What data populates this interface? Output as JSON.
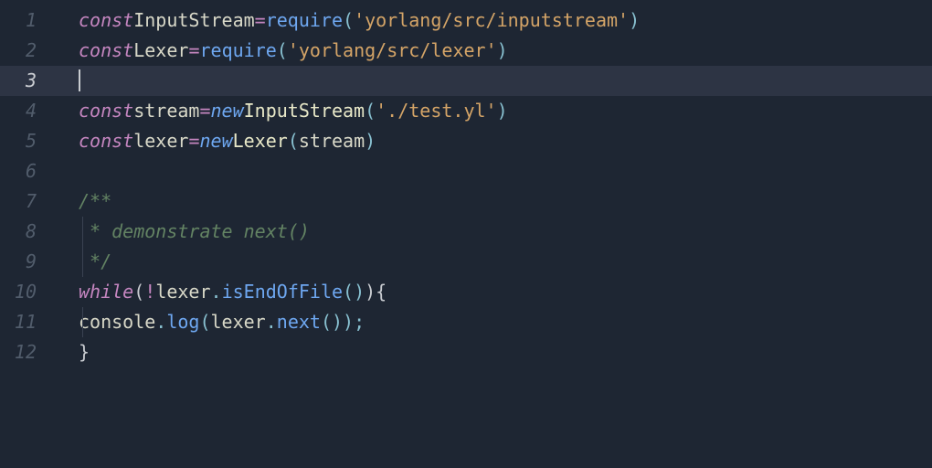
{
  "gutter": {
    "lines": [
      "1",
      "2",
      "3",
      "4",
      "5",
      "6",
      "7",
      "8",
      "9",
      "10",
      "11",
      "12"
    ],
    "active_line": 3
  },
  "code": {
    "l1": {
      "kw_const": "const",
      "var": "InputStream",
      "op_eq": "=",
      "fn": "require",
      "paren_o": "(",
      "str": "'yorlang/src/inputstream'",
      "paren_c": ")"
    },
    "l2": {
      "kw_const": "const",
      "var": "Lexer",
      "op_eq": "=",
      "fn": "require",
      "paren_o": "(",
      "str": "'yorlang/src/lexer'",
      "paren_c": ")"
    },
    "l4": {
      "kw_const": "const",
      "var": "stream",
      "op_eq": "=",
      "kw_new": "new",
      "class": "InputStream",
      "paren_o": "(",
      "str": "'./test.yl'",
      "paren_c": ")"
    },
    "l5": {
      "kw_const": "const",
      "var": "lexer",
      "op_eq": "=",
      "kw_new": "new",
      "class": "Lexer",
      "paren_o": "(",
      "arg": "stream",
      "paren_c": ")"
    },
    "l7": {
      "c": "/**"
    },
    "l8": {
      "c": " * demonstrate next()"
    },
    "l9": {
      "c": " */"
    },
    "l10": {
      "kw": "while",
      "paren_o": "(",
      "op_not": "!",
      "obj": "lexer",
      "dot": ".",
      "fn": "isEndOfFile",
      "paren_io": "(",
      "paren_ic": ")",
      "paren_c": ")",
      "brace_o": "{"
    },
    "l11": {
      "obj": "console",
      "dot1": ".",
      "fn": "log",
      "paren_o": "(",
      "obj2": "lexer",
      "dot2": ".",
      "fn2": "next",
      "paren_io": "(",
      "paren_ic": ")",
      "paren_c": ")",
      "semi": ";"
    },
    "l12": {
      "brace_c": "}"
    }
  }
}
